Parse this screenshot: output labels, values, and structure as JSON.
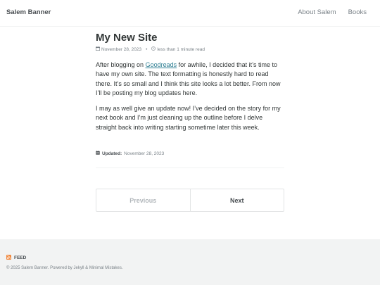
{
  "masthead": {
    "site_title": "Salem Banner",
    "nav": [
      "About Salem",
      "Books"
    ]
  },
  "post": {
    "title": "My New Site",
    "date": "November 28, 2023",
    "read_time": "less than 1 minute read",
    "p1_before": "After blogging on ",
    "p1_link": "Goodreads",
    "p1_after": " for awhile, I decided that it’s time to have my own site. The text formatting is honestly hard to read there. It’s so small and I think this site looks a lot better. From now I’ll be posting my blog updates here.",
    "p2": "I may as well give an update now! I’ve decided on the story for my next book and I’m just cleaning up the outline before I delve straight back into writing starting sometime later this week.",
    "updated_label": "Updated:",
    "updated_date": "November 28, 2023"
  },
  "pager": {
    "previous": "Previous",
    "next": "Next"
  },
  "footer": {
    "feed": "FEED",
    "copyright": "© 2025 Salem Banner. Powered by Jekyll & Minimal Mistakes."
  },
  "icons": {
    "calendar": "calendar-icon",
    "clock": "clock-icon",
    "rss": "rss-icon"
  },
  "colors": {
    "link": "#2f7f93",
    "footer_bg": "#f2f3f3",
    "rss": "#f0883e"
  }
}
